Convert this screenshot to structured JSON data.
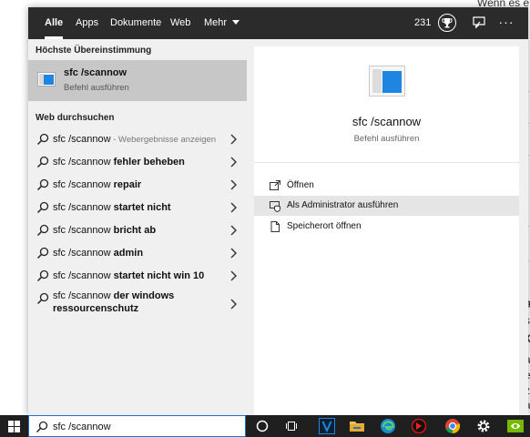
{
  "background": {
    "fragments": [
      "Wenn es e",
      "a",
      "s",
      "X",
      "a",
      "e",
      "z",
      "a"
    ]
  },
  "top_bar": {
    "tabs": [
      {
        "label": "Alle",
        "active": true
      },
      {
        "label": "Apps"
      },
      {
        "label": "Dokumente"
      },
      {
        "label": "Web"
      },
      {
        "label": "Mehr"
      }
    ],
    "score": "231",
    "more_glyph": "···"
  },
  "left": {
    "best_match_heading": "Höchste Übereinstimmung",
    "best_match": {
      "title": "sfc /scannow",
      "subtitle": "Befehl ausführen"
    },
    "web_heading": "Web durchsuchen",
    "web_items": [
      {
        "query": "sfc /scannow",
        "suffix": "",
        "hint": " - Webergebnisse anzeigen"
      },
      {
        "query": "sfc /scannow ",
        "suffix": "fehler beheben",
        "hint": ""
      },
      {
        "query": "sfc /scannow ",
        "suffix": "repair",
        "hint": ""
      },
      {
        "query": "sfc /scannow ",
        "suffix": "startet nicht",
        "hint": ""
      },
      {
        "query": "sfc /scannow ",
        "suffix": "bricht ab",
        "hint": ""
      },
      {
        "query": "sfc /scannow ",
        "suffix": "admin",
        "hint": ""
      },
      {
        "query": "sfc /scannow ",
        "suffix": "startet nicht win 10",
        "hint": ""
      },
      {
        "query": "sfc /scannow ",
        "suffix": "der windows ressourcenschutz",
        "hint": ""
      }
    ]
  },
  "right": {
    "title": "sfc /scannow",
    "subtitle": "Befehl ausführen",
    "actions": [
      {
        "label": "Öffnen",
        "icon": "open-icon"
      },
      {
        "label": "Als Administrator ausführen",
        "icon": "admin-shield-icon",
        "highlighted": true
      },
      {
        "label": "Speicherort öffnen",
        "icon": "file-location-icon"
      }
    ]
  },
  "taskbar": {
    "search_value": "sfc /scannow",
    "icons": [
      "cortana-icon",
      "task-view-icon",
      "vegas-icon",
      "file-explorer-icon",
      "edge-icon",
      "red-app-icon",
      "chrome-icon",
      "settings-gear-icon",
      "nvidia-icon"
    ]
  },
  "colors": {
    "accent": "#1e86e0",
    "top_bar": "#2b2b2b",
    "selected": "#c7c7c7",
    "taskbar": "#1f1f1f"
  }
}
